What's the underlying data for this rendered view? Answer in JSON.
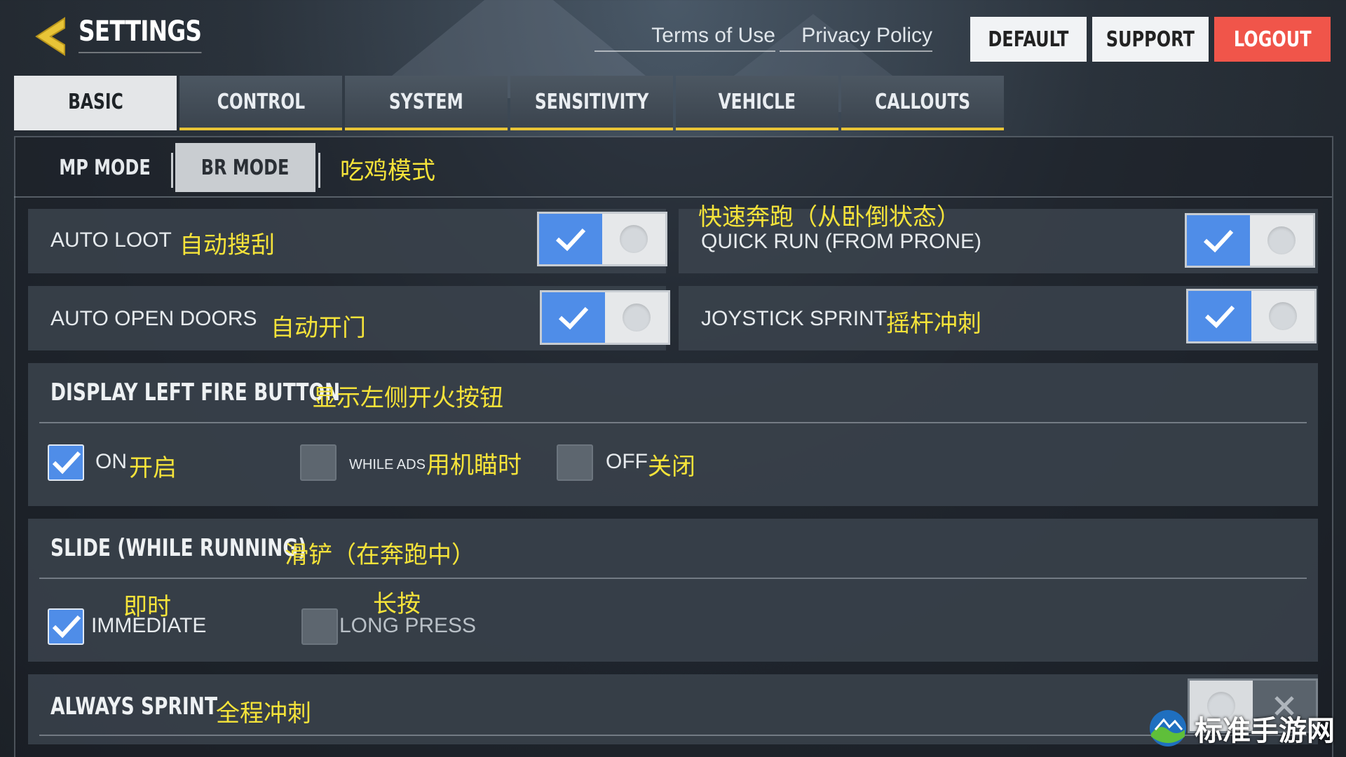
{
  "header": {
    "title": "SETTINGS",
    "links": {
      "terms": "Terms of Use",
      "privacy": "Privacy Policy"
    },
    "buttons": {
      "default": "DEFAULT",
      "support": "SUPPORT",
      "logout": "LOGOUT"
    }
  },
  "tabs": [
    {
      "label": "BASIC",
      "active": true
    },
    {
      "label": "CONTROL"
    },
    {
      "label": "SYSTEM"
    },
    {
      "label": "SENSITIVITY"
    },
    {
      "label": "VEHICLE"
    },
    {
      "label": "CALLOUTS"
    }
  ],
  "subtabs": {
    "mp": "MP MODE",
    "br": "BR MODE",
    "br_cn": "吃鸡模式",
    "active": "br"
  },
  "settings": {
    "auto_loot": {
      "label": "AUTO LOOT",
      "cn": "自动搜刮",
      "enabled": true
    },
    "quick_run": {
      "label": "QUICK RUN (FROM PRONE)",
      "cn": "快速奔跑（从卧倒状态）",
      "enabled": true
    },
    "auto_open_doors": {
      "label": "AUTO OPEN DOORS",
      "cn": "自动开门",
      "enabled": true
    },
    "joystick_sprint": {
      "label": "JOYSTICK SPRINT",
      "cn": "摇杆冲刺",
      "enabled": true
    },
    "left_fire": {
      "title": "DISPLAY LEFT FIRE BUTTON",
      "cn": "显示左侧开火按钮",
      "options": [
        {
          "label": "ON",
          "cn": "开启",
          "checked": true
        },
        {
          "label": "WHILE ADS",
          "cn": "用机瞄时",
          "checked": false
        },
        {
          "label": "OFF",
          "cn": "关闭",
          "checked": false
        }
      ]
    },
    "slide": {
      "title": "SLIDE (WHILE RUNNING)",
      "cn": "滑铲（在奔跑中）",
      "options": [
        {
          "label": "IMMEDIATE",
          "cn": "即时",
          "checked": true
        },
        {
          "label": "LONG PRESS",
          "cn": "长按",
          "checked": false
        }
      ]
    },
    "always_sprint": {
      "title": "ALWAYS SPRINT",
      "cn": "全程冲刺",
      "enabled": false
    }
  },
  "watermark": {
    "text": "标准手游网"
  },
  "colors": {
    "accent_blue": "#4f8de8",
    "tab_underline": "#e8c437",
    "logout_red": "#f0554a",
    "annotation_yellow": "#f5e33a"
  }
}
